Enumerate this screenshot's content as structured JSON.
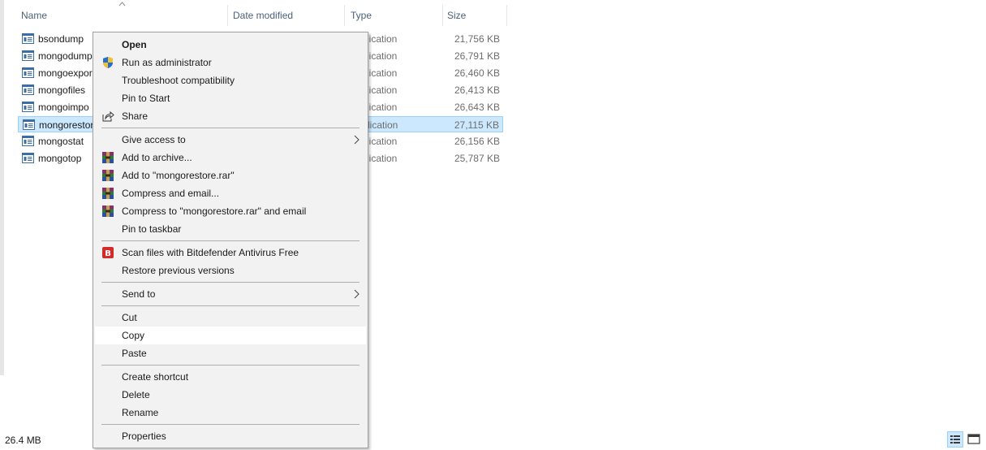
{
  "columns": {
    "name": "Name",
    "date_modified": "Date modified",
    "type": "Type",
    "size": "Size"
  },
  "files": [
    {
      "name": "bsondump",
      "type": "lication",
      "size": "21,756 KB",
      "selected": false
    },
    {
      "name": "mongodump",
      "type": "lication",
      "size": "26,791 KB",
      "selected": false
    },
    {
      "name": "mongoexpor",
      "type": "lication",
      "size": "26,460 KB",
      "selected": false
    },
    {
      "name": "mongofiles",
      "type": "lication",
      "size": "26,413 KB",
      "selected": false
    },
    {
      "name": "mongoimpo",
      "type": "lication",
      "size": "26,643 KB",
      "selected": false
    },
    {
      "name": "mongorestor",
      "type": "lication",
      "size": "27,115 KB",
      "selected": true
    },
    {
      "name": "mongostat",
      "type": "lication",
      "size": "26,156 KB",
      "selected": false
    },
    {
      "name": "mongotop",
      "type": "lication",
      "size": "25,787 KB",
      "selected": false
    }
  ],
  "context_menu": {
    "open": "Open",
    "run_as_admin": "Run as administrator",
    "troubleshoot": "Troubleshoot compatibility",
    "pin_start": "Pin to Start",
    "share": "Share",
    "give_access": "Give access to",
    "add_archive": "Add to archive...",
    "add_rar": "Add to \"mongorestore.rar\"",
    "compress_email": "Compress and email...",
    "compress_rar_email": "Compress to \"mongorestore.rar\" and email",
    "pin_taskbar": "Pin to taskbar",
    "scan_bitdefender": "Scan files with Bitdefender Antivirus Free",
    "restore_versions": "Restore previous versions",
    "send_to": "Send to",
    "cut": "Cut",
    "copy": "Copy",
    "paste": "Paste",
    "create_shortcut": "Create shortcut",
    "delete": "Delete",
    "rename": "Rename",
    "properties": "Properties",
    "hovered_item": "copy"
  },
  "status_bar": {
    "selection_size": "26.4 MB"
  },
  "colors": {
    "selection_bg": "#cce8ff",
    "selection_border": "#99d1ff",
    "menu_bg": "#f2f2f2",
    "header_text": "#4c607a",
    "bitdefender_red": "#d32a2a"
  }
}
